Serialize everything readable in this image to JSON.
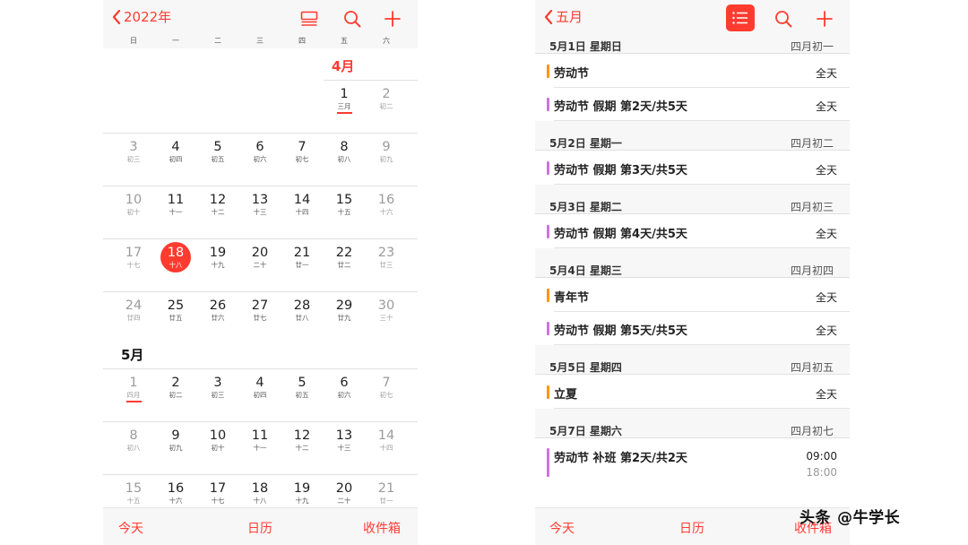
{
  "left": {
    "back_label": "2022年",
    "icons": [
      "calendar-grid-icon",
      "search-icon",
      "add-icon"
    ],
    "weekdays": [
      "日",
      "一",
      "二",
      "三",
      "四",
      "五",
      "六"
    ],
    "april_title": "4月",
    "may_title": "5月",
    "april_rows": [
      [
        null,
        null,
        null,
        null,
        null,
        {
          "n": "1",
          "l": "三月",
          "mark": true
        },
        {
          "n": "2",
          "l": "初二"
        }
      ],
      [
        {
          "n": "3",
          "l": "初三"
        },
        {
          "n": "4",
          "l": "初四"
        },
        {
          "n": "5",
          "l": "初五"
        },
        {
          "n": "6",
          "l": "初六"
        },
        {
          "n": "7",
          "l": "初七"
        },
        {
          "n": "8",
          "l": "初八"
        },
        {
          "n": "9",
          "l": "初九"
        }
      ],
      [
        {
          "n": "10",
          "l": "初十"
        },
        {
          "n": "11",
          "l": "十一"
        },
        {
          "n": "12",
          "l": "十二"
        },
        {
          "n": "13",
          "l": "十三"
        },
        {
          "n": "14",
          "l": "十四"
        },
        {
          "n": "15",
          "l": "十五"
        },
        {
          "n": "16",
          "l": "十六"
        }
      ],
      [
        {
          "n": "17",
          "l": "十七"
        },
        {
          "n": "18",
          "l": "十八",
          "today": true
        },
        {
          "n": "19",
          "l": "十九"
        },
        {
          "n": "20",
          "l": "二十"
        },
        {
          "n": "21",
          "l": "廿一"
        },
        {
          "n": "22",
          "l": "廿二"
        },
        {
          "n": "23",
          "l": "廿三"
        }
      ],
      [
        {
          "n": "24",
          "l": "廿四"
        },
        {
          "n": "25",
          "l": "廿五"
        },
        {
          "n": "26",
          "l": "廿六"
        },
        {
          "n": "27",
          "l": "廿七"
        },
        {
          "n": "28",
          "l": "廿八"
        },
        {
          "n": "29",
          "l": "廿九"
        },
        {
          "n": "30",
          "l": "三十"
        }
      ]
    ],
    "may_rows": [
      [
        {
          "n": "1",
          "l": "四月",
          "mark": true
        },
        {
          "n": "2",
          "l": "初二"
        },
        {
          "n": "3",
          "l": "初三"
        },
        {
          "n": "4",
          "l": "初四"
        },
        {
          "n": "5",
          "l": "初五"
        },
        {
          "n": "6",
          "l": "初六"
        },
        {
          "n": "7",
          "l": "初七"
        }
      ],
      [
        {
          "n": "8",
          "l": "初八"
        },
        {
          "n": "9",
          "l": "初九"
        },
        {
          "n": "10",
          "l": "初十"
        },
        {
          "n": "11",
          "l": "十一"
        },
        {
          "n": "12",
          "l": "十二"
        },
        {
          "n": "13",
          "l": "十三"
        },
        {
          "n": "14",
          "l": "十四"
        }
      ],
      [
        {
          "n": "15",
          "l": "十五"
        },
        {
          "n": "16",
          "l": "十六"
        },
        {
          "n": "17",
          "l": "十七"
        },
        {
          "n": "18",
          "l": "十八"
        },
        {
          "n": "19",
          "l": "十九"
        },
        {
          "n": "20",
          "l": "二十"
        },
        {
          "n": "21",
          "l": "廿一"
        }
      ]
    ],
    "bottom": {
      "today": "今天",
      "calendars": "日历",
      "inbox": "收件箱"
    }
  },
  "right": {
    "back_label": "五月",
    "icons": [
      "list-icon",
      "search-icon",
      "add-icon"
    ],
    "days": [
      {
        "date": "5月1日 星期日",
        "lunar": "四月初一",
        "events": [
          {
            "title": "劳动节",
            "right": "全天",
            "color": "#ff9500"
          },
          {
            "title": "劳动节 假期 第2天/共5天",
            "right": "全天",
            "color": "#cc73e1"
          }
        ]
      },
      {
        "date": "5月2日 星期一",
        "lunar": "四月初二",
        "events": [
          {
            "title": "劳动节 假期 第3天/共5天",
            "right": "全天",
            "color": "#cc73e1"
          }
        ]
      },
      {
        "date": "5月3日 星期二",
        "lunar": "四月初三",
        "events": [
          {
            "title": "劳动节 假期 第4天/共5天",
            "right": "全天",
            "color": "#cc73e1"
          }
        ]
      },
      {
        "date": "5月4日 星期三",
        "lunar": "四月初四",
        "events": [
          {
            "title": "青年节",
            "right": "全天",
            "color": "#ff9500"
          },
          {
            "title": "劳动节 假期 第5天/共5天",
            "right": "全天",
            "color": "#cc73e1"
          }
        ]
      },
      {
        "date": "5月5日 星期四",
        "lunar": "四月初五",
        "events": [
          {
            "title": "立夏",
            "right": "全天",
            "color": "#ff9500"
          }
        ]
      },
      {
        "date": "5月7日 星期六",
        "lunar": "四月初七",
        "events": [
          {
            "title": "劳动节 补班 第2天/共2天",
            "right": "09:00",
            "right2": "18:00",
            "color": "#cc73e1"
          }
        ]
      }
    ],
    "bottom": {
      "today": "今天",
      "calendars": "日历",
      "inbox": "收件箱"
    }
  },
  "watermark": {
    "prefix": "头条",
    "handle": "@牛学长"
  },
  "colors": {
    "accent": "#ff3b30",
    "holiday": "#ff9500",
    "vacation": "#cc73e1"
  }
}
